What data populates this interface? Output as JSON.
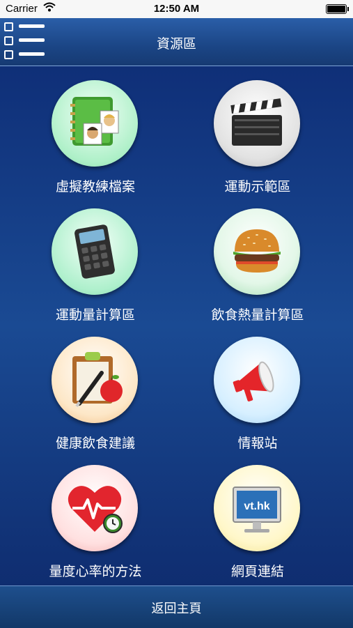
{
  "status_bar": {
    "carrier": "Carrier",
    "time": "12:50 AM"
  },
  "header": {
    "title": "資源區",
    "menu_icon": "list-menu-icon"
  },
  "grid": {
    "items": [
      {
        "label": "虛擬教練檔案",
        "icon": "address-book-icon"
      },
      {
        "label": "運動示範區",
        "icon": "clapperboard-icon"
      },
      {
        "label": "運動量計算區",
        "icon": "calculator-icon"
      },
      {
        "label": "飲食熱量計算區",
        "icon": "burger-icon"
      },
      {
        "label": "健康飲食建議",
        "icon": "clipboard-apple-icon"
      },
      {
        "label": "情報站",
        "icon": "megaphone-icon"
      },
      {
        "label": "量度心率的方法",
        "icon": "heart-rate-icon"
      },
      {
        "label": "網頁連結",
        "icon": "monitor-icon",
        "screen_text": "vt.hk"
      }
    ]
  },
  "footer": {
    "back_label": "返回主頁"
  },
  "colors": {
    "background": "#123a80",
    "navbar": "#1b4585",
    "text": "#ffffff"
  }
}
